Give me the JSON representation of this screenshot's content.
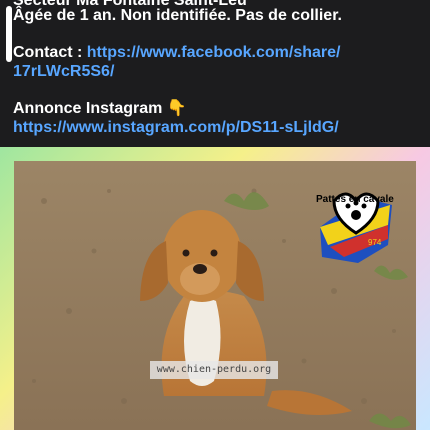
{
  "post": {
    "line1_partial": "Secteur Ma Fontaine Saint-Leu",
    "line2": "Âgée de 1 an. Non identifiée. Pas de collier.",
    "contact_label": "Contact : ",
    "contact_url_part1": "https://www.facebook.com/share/",
    "contact_url_part2": "17rLWcR5S6/",
    "instagram_label": "Annonce Instagram 👇",
    "instagram_url": "https://www.instagram.com/p/DS11-sLjldG/"
  },
  "image": {
    "logo_text": "Pattes en cavale",
    "logo_number": "974",
    "watermark": "www.chien-perdu.org"
  },
  "colors": {
    "background": "#1c1c1e",
    "text": "#ffffff",
    "link": "#58a6ff"
  }
}
